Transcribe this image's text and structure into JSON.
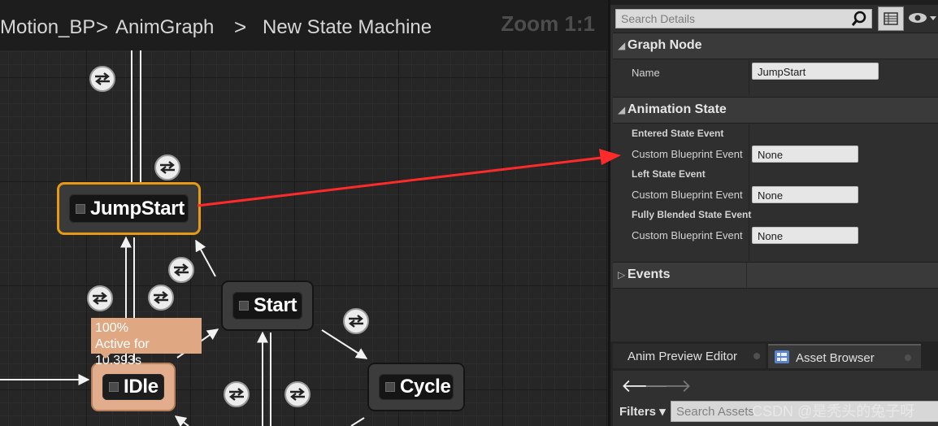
{
  "graph": {
    "breadcrumb": [
      "Motion_BP",
      "AnimGraph",
      "New State Machine"
    ],
    "breadcrumb_separators": [
      ">",
      ">"
    ],
    "zoom_label": "Zoom 1:1",
    "nodes": {
      "jumpstart": "JumpStart",
      "start": "Start",
      "idle": "IDle",
      "cycle": "Cycle"
    },
    "active_tooltip": {
      "percent": "100%",
      "active_text": "Active for 10.393s"
    },
    "selected_node_color": "#e69a14",
    "active_node_color": "#e2ad8c",
    "annotation_arrow_color": "#ff2a2a"
  },
  "details": {
    "search_placeholder": "Search Details",
    "sections": {
      "graph_node": {
        "title": "Graph Node",
        "name_label": "Name",
        "name_value": "JumpStart"
      },
      "animation_state": {
        "title": "Animation State",
        "entered_category": "Entered State Event",
        "entered_label": "Custom Blueprint Event",
        "entered_value": "None",
        "left_category": "Left State Event",
        "left_label": "Custom Blueprint Event",
        "left_value": "None",
        "blended_category": "Fully Blended State Event",
        "blended_label": "Custom Blueprint Event",
        "blended_value": "None"
      },
      "events": {
        "title": "Events"
      }
    }
  },
  "bottom_panel": {
    "tabs": [
      "Anim Preview Editor",
      "Asset Browser"
    ],
    "filters_label": "Filters",
    "search_placeholder": "Search Assets",
    "watermark": "CSDN @是秃头的兔子呀"
  }
}
